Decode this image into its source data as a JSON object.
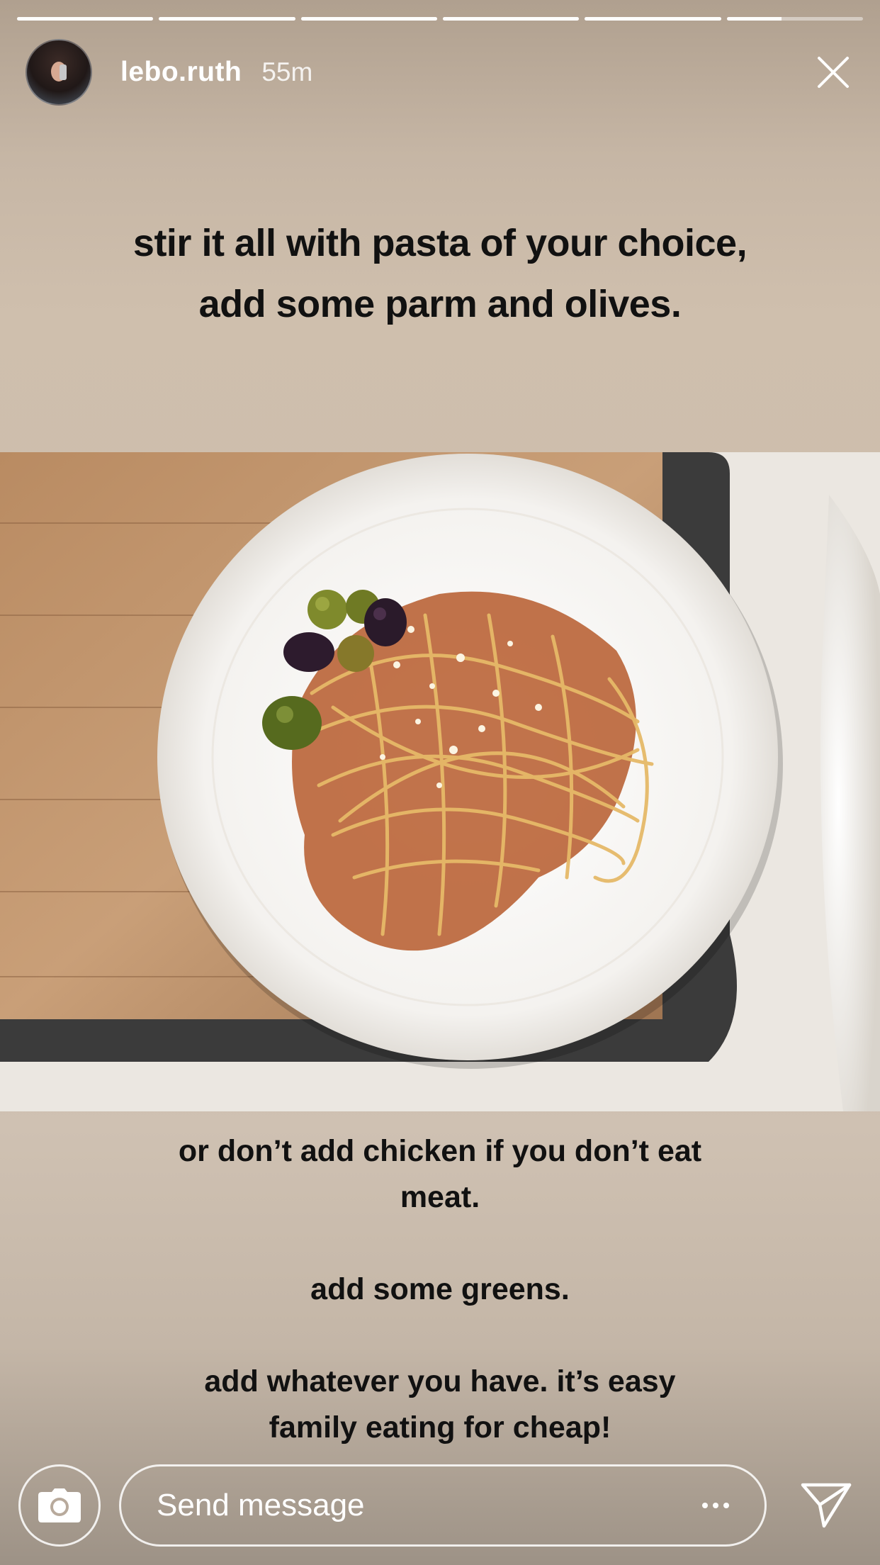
{
  "story": {
    "progress": [
      1,
      1,
      1,
      1,
      1,
      0.4
    ],
    "username": "lebo.ruth",
    "time_ago": "55m"
  },
  "caption_top": {
    "lines": [
      "stir it all with pasta of your choice,",
      "add some parm and olives."
    ]
  },
  "caption_bottom": {
    "lines": [
      "or don’t add chicken if you don’t eat",
      "meat.",
      "",
      "add some greens.",
      "",
      "add whatever you have. it’s easy",
      "family eating for cheap!"
    ]
  },
  "footer": {
    "message_placeholder": "Send message"
  },
  "icons": {
    "close": "close-icon",
    "camera": "camera-icon",
    "more": "more-dots-icon",
    "send": "send-paper-plane-icon"
  },
  "colors": {
    "text_dark": "#111111",
    "ui_white": "#ffffff"
  }
}
